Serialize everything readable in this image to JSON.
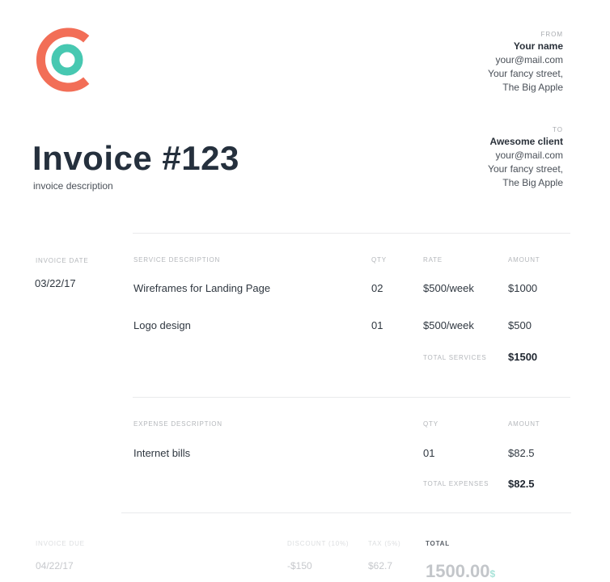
{
  "brand": {
    "primary": "#f26e57",
    "secondary": "#47c8b1"
  },
  "from": {
    "label": "FROM",
    "name": "Your name",
    "email": "your@mail.com",
    "street": "Your fancy street,",
    "city": "The Big Apple"
  },
  "to": {
    "label": "TO",
    "name": "Awesome client",
    "email": "your@mail.com",
    "street": "Your fancy street,",
    "city": "The Big Apple"
  },
  "invoice": {
    "title": "Invoice #123",
    "description": "invoice description",
    "date_label": "INVOICE DATE",
    "date": "03/22/17"
  },
  "services": {
    "headers": {
      "description": "SERVICE DESCRIPTION",
      "qty": "QTY",
      "rate": "RATE",
      "amount": "AMOUNT"
    },
    "rows": [
      {
        "description": "Wireframes for Landing Page",
        "qty": "02",
        "rate": "$500/week",
        "amount": "$1000"
      },
      {
        "description": "Logo design",
        "qty": "01",
        "rate": "$500/week",
        "amount": "$500"
      }
    ],
    "total_label": "TOTAL SERVICES",
    "total": "$1500"
  },
  "expenses": {
    "headers": {
      "description": "EXPENSE DESCRIPTION",
      "qty": "QTY",
      "amount": "AMOUNT"
    },
    "rows": [
      {
        "description": "Internet bills",
        "qty": "01",
        "amount": "$82.5"
      }
    ],
    "total_label": "TOTAL EXPENSES",
    "total": "$82.5"
  },
  "summary": {
    "due_label": "INVOICE DUE",
    "due_date": "04/22/17",
    "discount_label": "DISCOUNT (10%)",
    "discount": "-$150",
    "tax_label": "TAX (5%)",
    "tax": "$62.7",
    "total_label": "TOTAL",
    "total": "1500.00",
    "currency": "$"
  }
}
